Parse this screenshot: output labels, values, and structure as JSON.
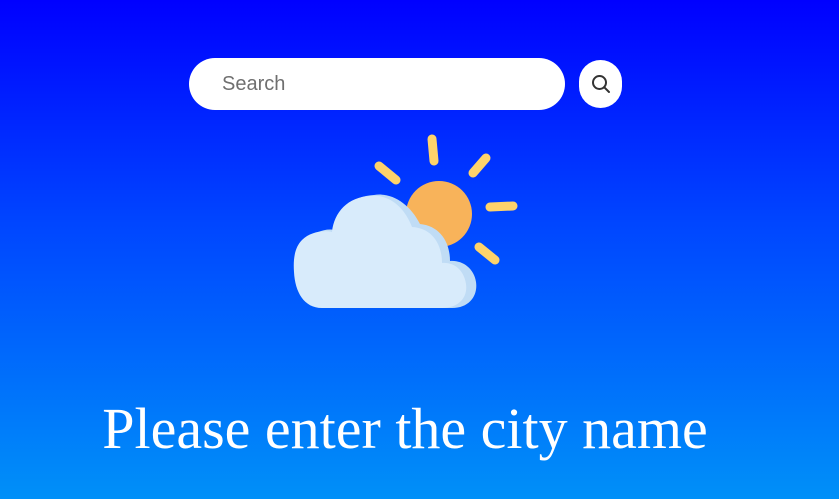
{
  "search": {
    "placeholder": "Search",
    "value": "",
    "button_icon": "search-icon"
  },
  "weather": {
    "icon": "partly-cloudy-icon",
    "sun_color": "#f8b35a",
    "ray_color": "#fed36b",
    "cloud_color": "#d8ebfb",
    "cloud_shadow_color": "#c0dcf5"
  },
  "message": {
    "text": "Please enter the city name"
  },
  "colors": {
    "background_top": "#0000ff",
    "background_bottom": "#0090f8"
  }
}
